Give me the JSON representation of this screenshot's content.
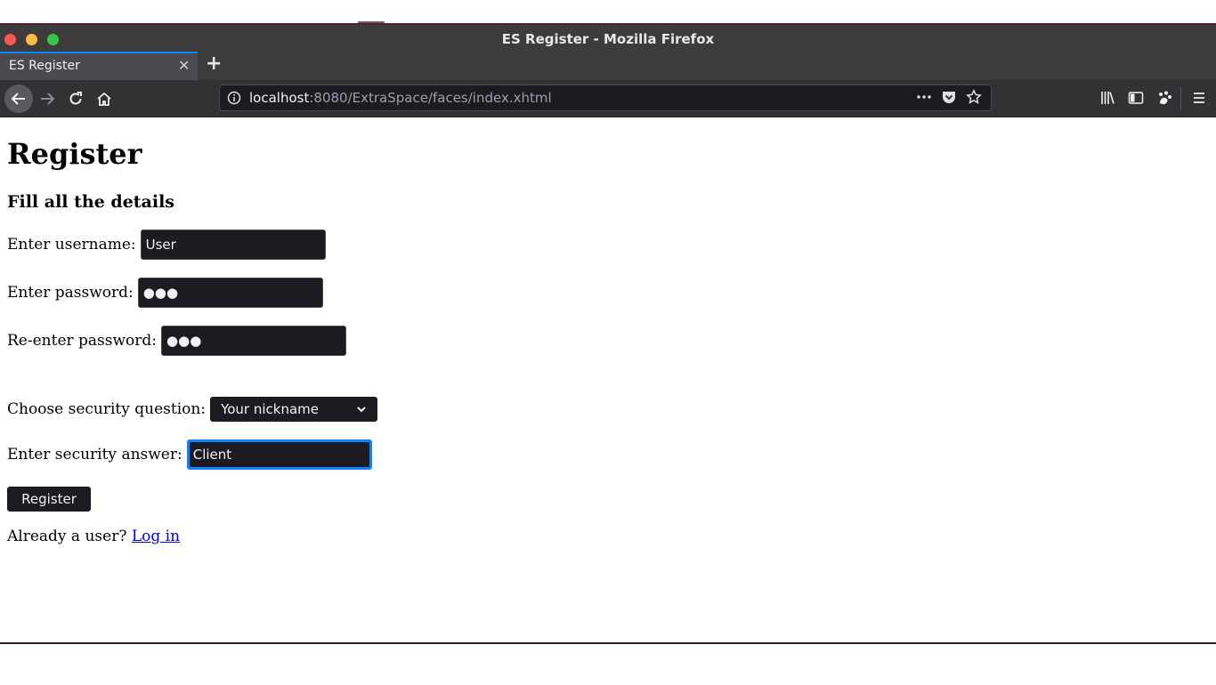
{
  "browser": {
    "window_title": "ES Register - Mozilla Firefox",
    "tab_title": "ES Register",
    "tab_close": "✕",
    "new_tab": "+",
    "url_host": "localhost",
    "url_rest": ":8080/ExtraSpace/faces/index.xhtml",
    "accent_color": "#0a84ff"
  },
  "page": {
    "title": "Register",
    "subtitle": "Fill all the details",
    "form": {
      "username_label": "Enter username:",
      "username_value": "User",
      "password_label": "Enter password:",
      "password_value": "●●●",
      "reenter_label": "Re-enter password:",
      "reenter_value": "●●●",
      "question_label": "Choose security question:",
      "question_selected": "Your nickname",
      "answer_label": "Enter security answer:",
      "answer_value": "Client",
      "register_button": "Register"
    },
    "login_prompt": "Already a user?",
    "login_link": "Log in",
    "link_color": "#0000ee"
  }
}
